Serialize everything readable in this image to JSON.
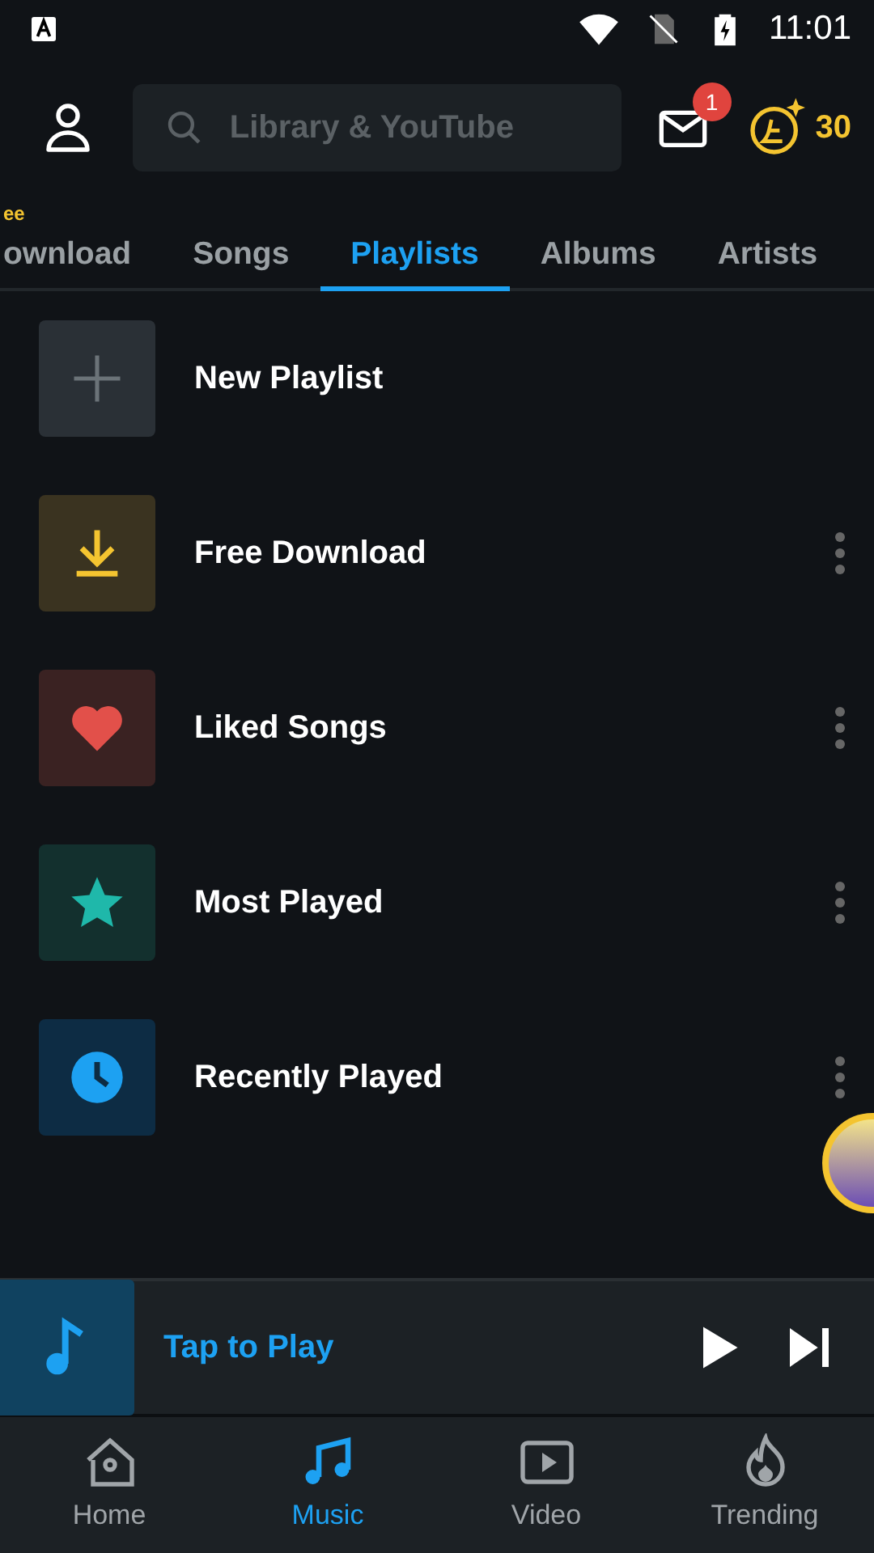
{
  "status_bar": {
    "time": "11:01"
  },
  "header": {
    "search": {
      "placeholder": "Library & YouTube"
    },
    "mail_badge": "1",
    "coins": "30"
  },
  "tabs": [
    {
      "label": "ownload",
      "badge": "ee",
      "selected": false
    },
    {
      "label": "Songs",
      "selected": false
    },
    {
      "label": "Playlists",
      "selected": true
    },
    {
      "label": "Albums",
      "selected": false
    },
    {
      "label": "Artists",
      "selected": false
    }
  ],
  "playlists": [
    {
      "kind": "new",
      "title": "New Playlist",
      "menu": false
    },
    {
      "kind": "download",
      "title": "Free Download",
      "menu": true
    },
    {
      "kind": "liked",
      "title": "Liked Songs",
      "menu": true
    },
    {
      "kind": "most",
      "title": "Most Played",
      "menu": true
    },
    {
      "kind": "recent",
      "title": "Recently Played",
      "menu": true
    }
  ],
  "player": {
    "title": "Tap to Play"
  },
  "bottom_nav": [
    {
      "kind": "home",
      "label": "Home",
      "selected": false
    },
    {
      "kind": "music",
      "label": "Music",
      "selected": true
    },
    {
      "kind": "video",
      "label": "Video",
      "selected": false
    },
    {
      "kind": "trending",
      "label": "Trending",
      "selected": false
    }
  ]
}
